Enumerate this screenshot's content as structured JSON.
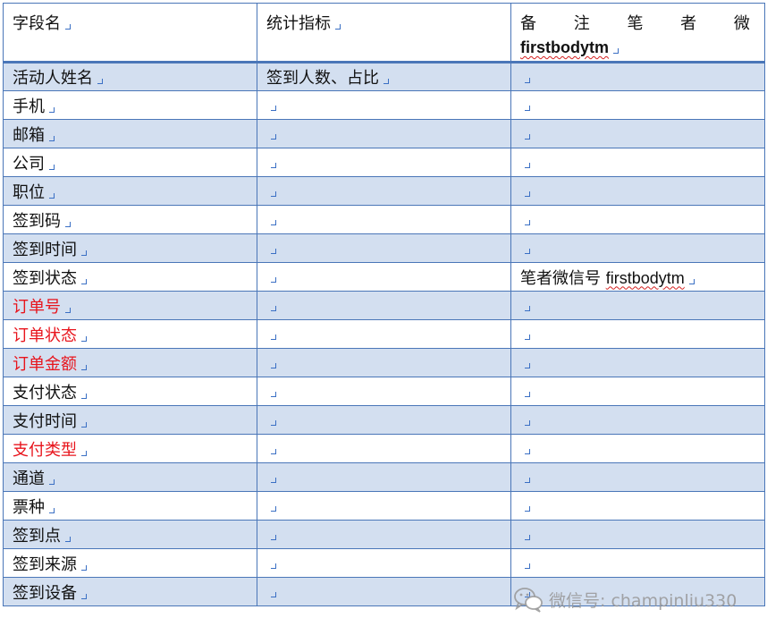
{
  "table": {
    "header": {
      "col1": "字段名",
      "col2": "统计指标",
      "col3_line1": "备 注 笔 者 微 信 号",
      "col3_line2": "firstbodytm"
    },
    "rows": [
      {
        "name": "活动人姓名",
        "metric": "签到人数、占比",
        "note": "",
        "red": false
      },
      {
        "name": "手机",
        "metric": "",
        "note": "",
        "red": false
      },
      {
        "name": "邮箱",
        "metric": "",
        "note": "",
        "red": false
      },
      {
        "name": "公司",
        "metric": "",
        "note": "",
        "red": false
      },
      {
        "name": "职位",
        "metric": "",
        "note": "",
        "red": false
      },
      {
        "name": "签到码",
        "metric": "",
        "note": "",
        "red": false
      },
      {
        "name": "签到时间",
        "metric": "",
        "note": "",
        "red": false
      },
      {
        "name": "签到状态",
        "metric": "",
        "note": "笔者微信号 firstbodytm",
        "red": false
      },
      {
        "name": "订单号",
        "metric": "",
        "note": "",
        "red": true
      },
      {
        "name": "订单状态",
        "metric": "",
        "note": "",
        "red": true
      },
      {
        "name": "订单金额",
        "metric": "",
        "note": "",
        "red": true
      },
      {
        "name": "支付状态",
        "metric": "",
        "note": "",
        "red": false
      },
      {
        "name": "支付时间",
        "metric": "",
        "note": "",
        "red": false
      },
      {
        "name": "支付类型",
        "metric": "",
        "note": "",
        "red": true
      },
      {
        "name": "通道",
        "metric": "",
        "note": "",
        "red": false
      },
      {
        "name": "票种",
        "metric": "",
        "note": "",
        "red": false
      },
      {
        "name": "签到点",
        "metric": "",
        "note": "",
        "red": false
      },
      {
        "name": "签到来源",
        "metric": "",
        "note": "",
        "red": false
      },
      {
        "name": "签到设备",
        "metric": "",
        "note": "",
        "red": false
      }
    ]
  },
  "watermark": {
    "text": "微信号: champinliu330",
    "icon": "wechat-icon"
  },
  "colors": {
    "border": "#4a76b8",
    "shaded_row": "#d3dff0",
    "red_text": "#e8141c",
    "paragraph_mark": "#3a6fc4"
  }
}
